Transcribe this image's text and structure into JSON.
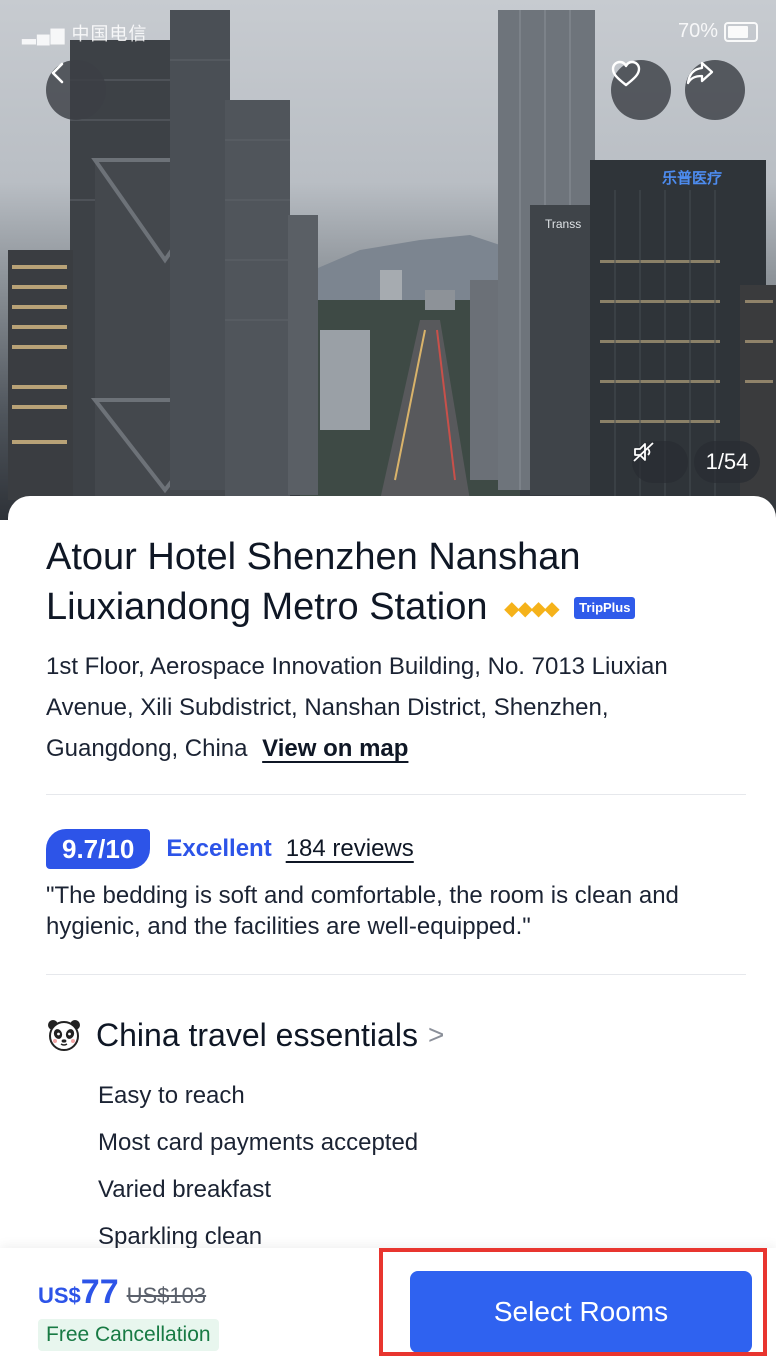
{
  "status_bar": {
    "carrier": "中国电信",
    "battery": "70%"
  },
  "gallery": {
    "counter": "1/54",
    "sign_text": "乐普医疗",
    "sign_text_2": "Transs"
  },
  "hotel": {
    "name": "Atour Hotel Shenzhen Nanshan Liuxiandong Metro Station",
    "badge": "TripPlus",
    "address": "1st Floor, Aerospace Innovation Building, No. 7013 Liuxian Avenue, Xili Subdistrict, Nanshan District, Shenzhen, Guangdong, China",
    "view_on_map": "View on map"
  },
  "rating": {
    "score": "9.7",
    "max": "/10",
    "label": "Excellent",
    "reviews": "184 reviews",
    "quote": "\"The bedding is soft and comfortable, the room is clean and hygienic, and the facilities are well-equipped.\""
  },
  "essentials": {
    "title": "China travel essentials",
    "chevron": ">",
    "items": [
      "Easy to reach",
      "Most card payments accepted",
      "Varied breakfast",
      "Sparkling clean"
    ]
  },
  "booking": {
    "currency": "US$",
    "price": "77",
    "original_price": "US$103",
    "free_cancellation": "Free Cancellation",
    "select_rooms": "Select Rooms"
  },
  "colors": {
    "accent": "#2d54e8",
    "highlight": "#e8352f",
    "stars": "#f5b21a"
  }
}
